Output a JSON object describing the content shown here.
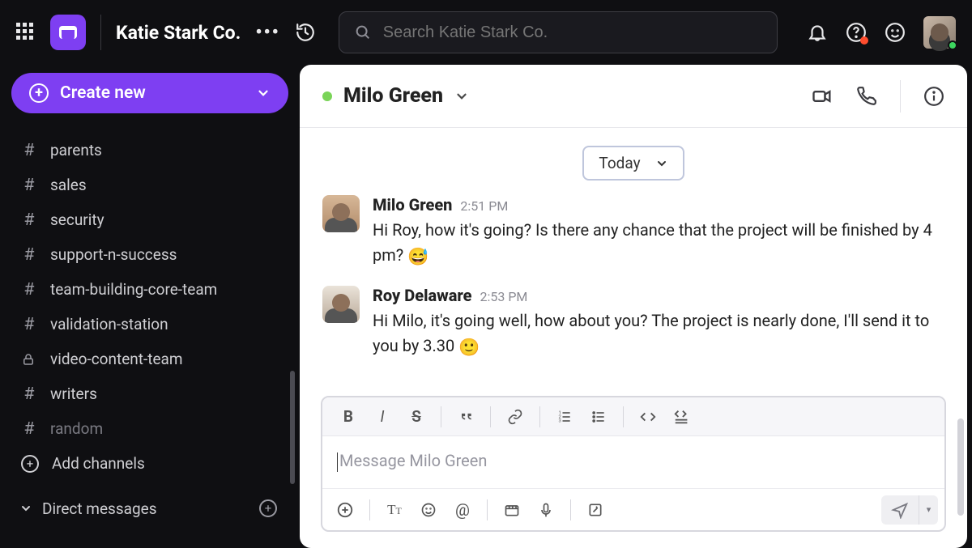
{
  "header": {
    "workspace_name": "Katie Stark Co.",
    "search_placeholder": "Search Katie Stark Co."
  },
  "sidebar": {
    "create_label": "Create new",
    "channels": [
      {
        "name": "parents",
        "icon": "hash"
      },
      {
        "name": "sales",
        "icon": "hash"
      },
      {
        "name": "security",
        "icon": "hash"
      },
      {
        "name": "support-n-success",
        "icon": "hash"
      },
      {
        "name": "team-building-core-team",
        "icon": "hash"
      },
      {
        "name": "validation-station",
        "icon": "hash"
      },
      {
        "name": "video-content-team",
        "icon": "lock"
      },
      {
        "name": "writers",
        "icon": "hash"
      },
      {
        "name": "random",
        "icon": "hash",
        "dim": true
      }
    ],
    "add_channels_label": "Add channels",
    "dm_section_label": "Direct messages"
  },
  "chat": {
    "contact_name": "Milo Green",
    "date_divider": "Today",
    "messages": [
      {
        "author": "Milo Green",
        "time": "2:51 PM",
        "text": "Hi Roy, how it's going? Is there any chance that the project will be finished by 4 pm? ",
        "emoji": "😅",
        "avatar": "milo"
      },
      {
        "author": "Roy Delaware",
        "time": "2:53 PM",
        "text": "Hi Milo, it's going well, how about you? The project is nearly done, I'll send it to you by 3.30 ",
        "emoji": "🙂",
        "avatar": "roy"
      }
    ],
    "compose_placeholder": "Message Milo Green"
  }
}
